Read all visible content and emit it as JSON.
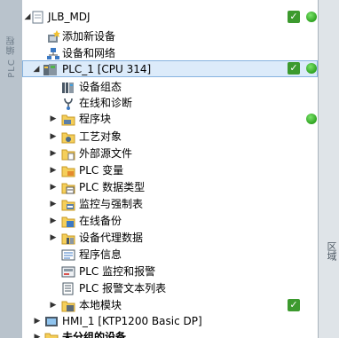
{
  "side_tabs": {
    "left": "PLC 编程",
    "right": "区域"
  },
  "colors": {
    "status_ok": "#3c9a2e",
    "online_dot": "#2fa321",
    "selection_bg": "#dcebfa"
  },
  "tree": {
    "items": [
      {
        "label": "JLB_MDJ",
        "icon": "project-icon",
        "arrow": "expanded",
        "check": true,
        "dot": true
      },
      {
        "label": "添加新设备",
        "icon": "add-device-icon"
      },
      {
        "label": "设备和网络",
        "icon": "network-icon"
      },
      {
        "label": "PLC_1 [CPU 314]",
        "icon": "plc-icon",
        "arrow": "expanded",
        "check": true,
        "dot": true,
        "selected": true
      },
      {
        "label": "设备组态",
        "icon": "device-config-icon"
      },
      {
        "label": "在线和诊断",
        "icon": "diagnostics-icon"
      },
      {
        "label": "程序块",
        "icon": "folder-icon",
        "arrow": "collapsed",
        "dot": true
      },
      {
        "label": "工艺对象",
        "icon": "folder-icon",
        "arrow": "collapsed"
      },
      {
        "label": "外部源文件",
        "icon": "folder-icon",
        "arrow": "collapsed"
      },
      {
        "label": "PLC 变量",
        "icon": "folder-icon",
        "arrow": "collapsed"
      },
      {
        "label": "PLC 数据类型",
        "icon": "folder-icon",
        "arrow": "collapsed"
      },
      {
        "label": "监控与强制表",
        "icon": "folder-icon",
        "arrow": "collapsed"
      },
      {
        "label": "在线备份",
        "icon": "folder-icon",
        "arrow": "collapsed"
      },
      {
        "label": "设备代理数据",
        "icon": "folder-icon",
        "arrow": "collapsed"
      },
      {
        "label": "程序信息",
        "icon": "program-info-icon"
      },
      {
        "label": "PLC 监控和报警",
        "icon": "alarm-icon"
      },
      {
        "label": "PLC 报警文本列表",
        "icon": "text-list-icon"
      },
      {
        "label": "本地模块",
        "icon": "folder-icon",
        "arrow": "collapsed",
        "check": true
      },
      {
        "label": "HMI_1 [KTP1200 Basic DP]",
        "icon": "hmi-icon",
        "arrow": "collapsed"
      },
      {
        "label": "未分组的设备",
        "icon": "folder-icon",
        "arrow": "collapsed",
        "bold": true
      }
    ]
  }
}
